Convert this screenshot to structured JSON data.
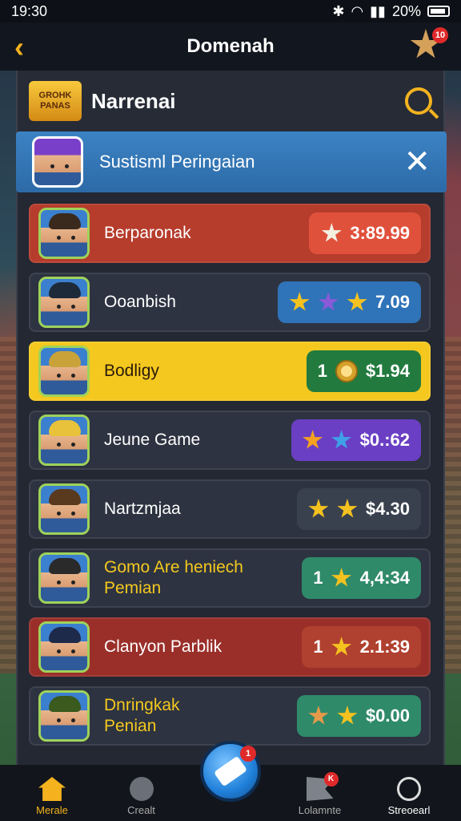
{
  "status": {
    "time": "19:30",
    "battery": "20%"
  },
  "header": {
    "title": "Domenah",
    "badge_count": "10"
  },
  "panel": {
    "logo_line1": "GROHK",
    "logo_line2": "PANAS",
    "title": "Narrenai"
  },
  "banner": {
    "text": "Sustisml Peringaian"
  },
  "rows": [
    {
      "name": "Berparonak",
      "value": "3:89.99",
      "row_color": "#b63c2c",
      "pill_color": "#e0513c",
      "stars": [
        "#f3f0e0"
      ],
      "prefix": "",
      "coin": false
    },
    {
      "name": "Ooanbish",
      "value": "7.09",
      "row_color": "#2d3340",
      "pill_color": "#2f73b8",
      "stars": [
        "#f4c21f",
        "#8a5ad8",
        "#f4c21f"
      ],
      "prefix": "",
      "coin": false
    },
    {
      "name": "Bodligy",
      "value": "$1.94",
      "row_color": "#f4c81f",
      "pill_color": "#227a3e",
      "stars": [],
      "prefix": "1",
      "coin": true
    },
    {
      "name": "Jeune Game",
      "value": "$0.:62",
      "row_color": "#2d3340",
      "pill_color": "#6a3fc4",
      "stars": [
        "#f4a21f",
        "#3fa0e8"
      ],
      "prefix": "",
      "coin": false
    },
    {
      "name": "Nartzmjaa",
      "value": "$4.30",
      "row_color": "#2d3340",
      "pill_color": "#3a414e",
      "stars": [
        "#f4c21f",
        "#f4c21f"
      ],
      "prefix": "",
      "coin": false
    },
    {
      "name": "Gomo Are heniech\nPemian",
      "value": "4,4:34",
      "row_color": "#2d3340",
      "pill_color": "#2f8a6a",
      "stars": [
        "#f4c21f"
      ],
      "prefix": "1",
      "coin": false,
      "name_color": "#f4c81f"
    },
    {
      "name": "Clanyon Parblik",
      "value": "2.1:39",
      "row_color": "#9a2f2a",
      "pill_color": "#b0402f",
      "stars": [
        "#f4c21f"
      ],
      "prefix": "1",
      "coin": false
    },
    {
      "name": "Dnringkak\nPenian",
      "value": "$0.00",
      "row_color": "#2d3340",
      "pill_color": "#2f8a6a",
      "stars": [
        "#e59a4a",
        "#f4c21f"
      ],
      "prefix": "",
      "coin": false,
      "name_color": "#f4c81f"
    }
  ],
  "nav": {
    "home": "Merale",
    "second": "Crealt",
    "fab_badge": "1",
    "fourth": "Lolamnte",
    "fourth_badge": "K",
    "fifth": "Streoearl"
  }
}
